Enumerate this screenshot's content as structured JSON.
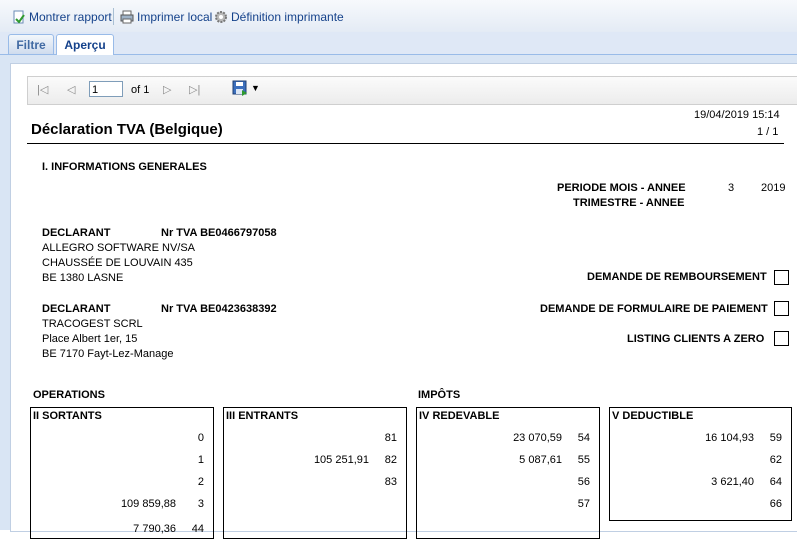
{
  "toolbar": {
    "show_report": "Montrer rapport",
    "print_local": "Imprimer local",
    "printer_definition": "Définition imprimante"
  },
  "tabs": [
    "Filtre",
    "Aperçu"
  ],
  "viewer": {
    "page_value": "1",
    "page_of": "of 1"
  },
  "report": {
    "datetime": "19/04/2019 15:14",
    "page": "1 / 1",
    "title": "Déclaration TVA (Belgique)",
    "section_general": "I. INFORMATIONS GENERALES",
    "period_month_label": "PERIODE MOIS - ANNEE",
    "period_month": "3",
    "period_year": "2019",
    "period_quarter_label": "TRIMESTRE - ANNEE",
    "declarant1": {
      "label": "DECLARANT",
      "vat": "Nr TVA BE0466797058",
      "lines": [
        "ALLEGRO SOFTWARE NV/SA",
        "CHAUSSÉE DE LOUVAIN 435",
        "BE 1380 LASNE"
      ]
    },
    "declarant2": {
      "label": "DECLARANT",
      "vat": "Nr TVA BE0423638392",
      "lines": [
        "TRACOGEST SCRL",
        "Place Albert 1er, 15",
        "BE 7170 Fayt-Lez-Manage"
      ]
    },
    "checkboxes": {
      "refund": "DEMANDE DE REMBOURSEMENT",
      "payment_form": "DEMANDE DE FORMULAIRE DE PAIEMENT",
      "listing_zero": "LISTING CLIENTS A ZERO"
    },
    "operations_label": "OPERATIONS",
    "taxes_label": "IMPÔTS",
    "boxes": {
      "sortants": {
        "title": "II SORTANTS",
        "rows": [
          [
            "",
            "0"
          ],
          [
            "",
            "1"
          ],
          [
            "",
            "2"
          ],
          [
            "109 859,88",
            "3"
          ],
          [
            "7 790,36",
            "44"
          ]
        ]
      },
      "entrants": {
        "title": "III ENTRANTS",
        "rows": [
          [
            "",
            "81"
          ],
          [
            "105 251,91",
            "82"
          ],
          [
            "",
            "83"
          ]
        ]
      },
      "redevable": {
        "title": "IV REDEVABLE",
        "rows": [
          [
            "23 070,59",
            "54"
          ],
          [
            "5 087,61",
            "55"
          ],
          [
            "",
            "56"
          ],
          [
            "",
            "57"
          ]
        ]
      },
      "deductible": {
        "title": "V DEDUCTIBLE",
        "rows": [
          [
            "16 104,93",
            "59"
          ],
          [
            "",
            "62"
          ],
          [
            "3 621,40",
            "64"
          ],
          [
            "",
            "66"
          ]
        ]
      }
    }
  }
}
